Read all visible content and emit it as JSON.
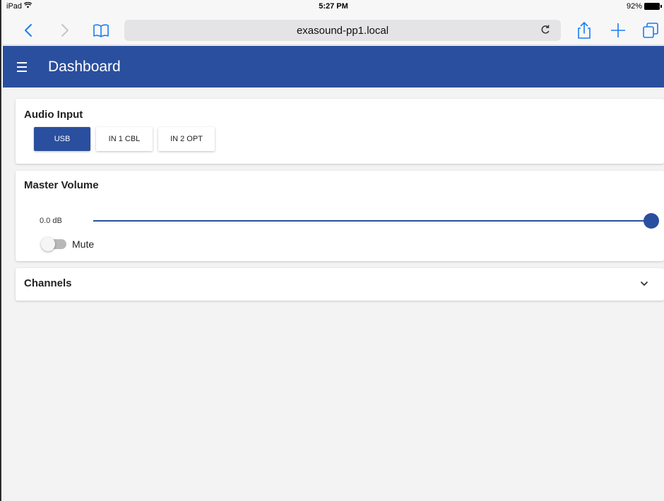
{
  "status_bar": {
    "device": "iPad",
    "time": "5:27 PM",
    "battery": "92%"
  },
  "browser": {
    "url": "exasound-pp1.local",
    "icons": [
      "back-icon",
      "forward-icon",
      "bookmarks-icon",
      "reload-icon",
      "share-icon",
      "new-tab-icon",
      "tabs-icon"
    ]
  },
  "app_bar": {
    "title": "Dashboard",
    "color": "#2a4f9e"
  },
  "audio_input": {
    "title": "Audio Input",
    "options": [
      "USB",
      "IN 1 CBL",
      "IN 2 OPT"
    ],
    "selected": "USB"
  },
  "master_volume": {
    "title": "Master Volume",
    "value_label": "0.0 dB",
    "level": 1.0,
    "mute_label": "Mute",
    "muted": false
  },
  "channels": {
    "title": "Channels",
    "expanded": false
  }
}
